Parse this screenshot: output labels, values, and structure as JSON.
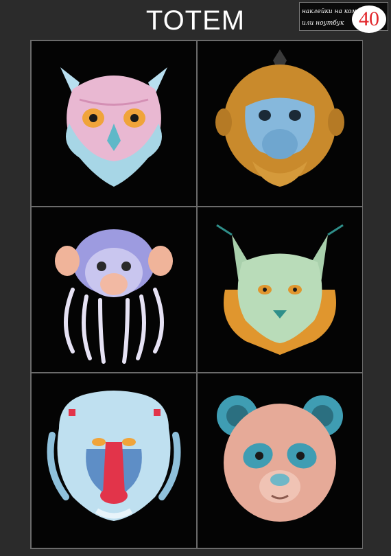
{
  "header": {
    "title": "TOTEM",
    "label_line1": "наклейки на комп",
    "label_line2": "или ноутбук",
    "label_no": "N",
    "badge_number": "40"
  },
  "tiles": [
    {
      "name": "owl",
      "icon": "owl-head-icon",
      "colors": [
        "#e7b6cf",
        "#a6d4e4",
        "#f0a43a"
      ]
    },
    {
      "name": "monkey",
      "icon": "golden-monkey-head-icon",
      "colors": [
        "#c98a2c",
        "#7fb2d8",
        "#3a3a3a"
      ]
    },
    {
      "name": "tamarin",
      "icon": "tamarin-head-icon",
      "colors": [
        "#9d9be0",
        "#f2b9a3",
        "#e6e2f4"
      ]
    },
    {
      "name": "lynx",
      "icon": "lynx-head-icon",
      "colors": [
        "#a9d0ac",
        "#e0962e",
        "#2f8f8a"
      ]
    },
    {
      "name": "mandrill",
      "icon": "mandrill-head-icon",
      "colors": [
        "#bfe0f0",
        "#e2344a",
        "#5e8ec6"
      ]
    },
    {
      "name": "panda",
      "icon": "panda-head-icon",
      "colors": [
        "#e6aa98",
        "#3f9db3",
        "#6fb7c7"
      ]
    }
  ]
}
